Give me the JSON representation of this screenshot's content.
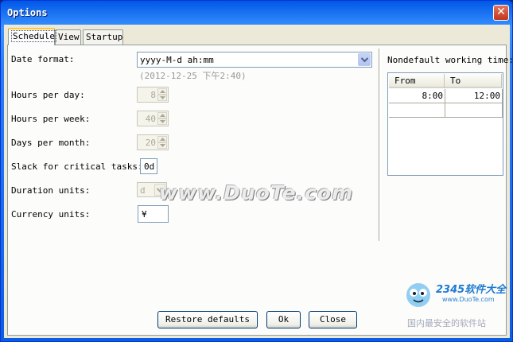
{
  "window": {
    "title": "Options",
    "close_glyph": "✕"
  },
  "tabs": [
    {
      "label": "Schedule"
    },
    {
      "label": "View"
    },
    {
      "label": "Startup"
    }
  ],
  "schedule": {
    "date_format_label": "Date format:",
    "date_format_value": "yyyy-M-d ah:mm",
    "date_format_example": "(2012-12-25 下午2:40)",
    "hours_per_day_label": "Hours per day:",
    "hours_per_day_value": "8",
    "hours_per_week_label": "Hours per week:",
    "hours_per_week_value": "40",
    "days_per_month_label": "Days per month:",
    "days_per_month_value": "20",
    "slack_label": "Slack for critical tasks:",
    "slack_value": "0d",
    "duration_units_label": "Duration units:",
    "duration_units_value": "d",
    "currency_units_label": "Currency units:",
    "currency_units_value": "¥"
  },
  "working_time": {
    "label": "Nondefault working time:",
    "columns": [
      "From",
      "To"
    ],
    "rows": [
      {
        "from": "8:00",
        "to": "12:00"
      },
      {
        "from": "",
        "to": ""
      }
    ]
  },
  "buttons": {
    "restore": "Restore defaults",
    "ok": "Ok",
    "close": "Close"
  },
  "watermark": {
    "text": "www.DuoTe.com"
  },
  "site_logo": {
    "brand": "2345软件大全",
    "url": "www.DuoTe.com",
    "slogan": "国内最安全的软件站"
  },
  "colors": {
    "title_bar": "#2a7df5",
    "close_button": "#c1371a",
    "dialog_bg": "#ece9d8",
    "active_tab_accent": "#ffc83c"
  }
}
